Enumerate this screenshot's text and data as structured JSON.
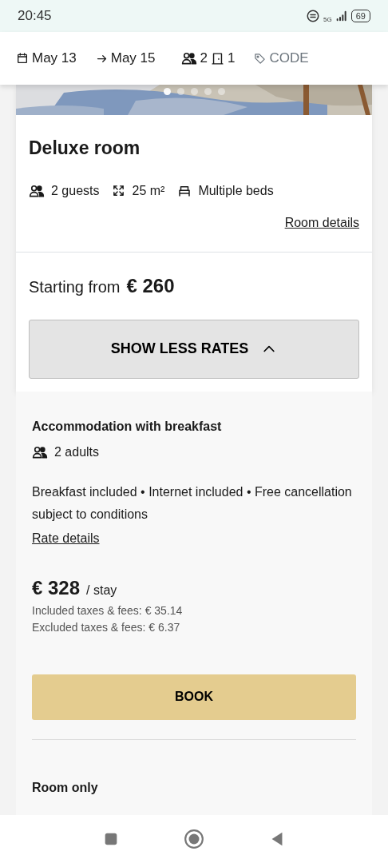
{
  "status_bar": {
    "time": "20:45",
    "network": "5G",
    "battery": "69"
  },
  "search_bar": {
    "check_in": "May 13",
    "check_out": "May 15",
    "guests": "2",
    "rooms": "1",
    "promo": "CODE"
  },
  "room": {
    "carousel_dots": [
      {
        "selected": true
      },
      {
        "selected": false
      },
      {
        "selected": false
      },
      {
        "selected": false
      },
      {
        "selected": false
      }
    ],
    "title": "Deluxe room",
    "features": [
      {
        "kind": "guests",
        "label": "2 guests"
      },
      {
        "kind": "size",
        "label": "25 m²"
      },
      {
        "kind": "beds",
        "label": "Multiple beds"
      }
    ],
    "details_link": "Room details",
    "starting_label": "Starting from",
    "starting_price": "€ 260",
    "toggle_button": {
      "label": "SHOW LESS RATES",
      "expanded": true
    }
  },
  "rates": [
    {
      "name": "Accommodation with breakfast",
      "occupancy": "2 adults",
      "description": "Breakfast included • Internet included • Free cancellation subject to conditions",
      "details_link": "Rate details",
      "price": "€ 328",
      "per": "/ stay",
      "taxes": [
        "Included taxes & fees: € 35.14",
        "Excluded taxes & fees: € 6.37"
      ],
      "book": "BOOK"
    },
    {
      "name": "Room only"
    }
  ]
}
